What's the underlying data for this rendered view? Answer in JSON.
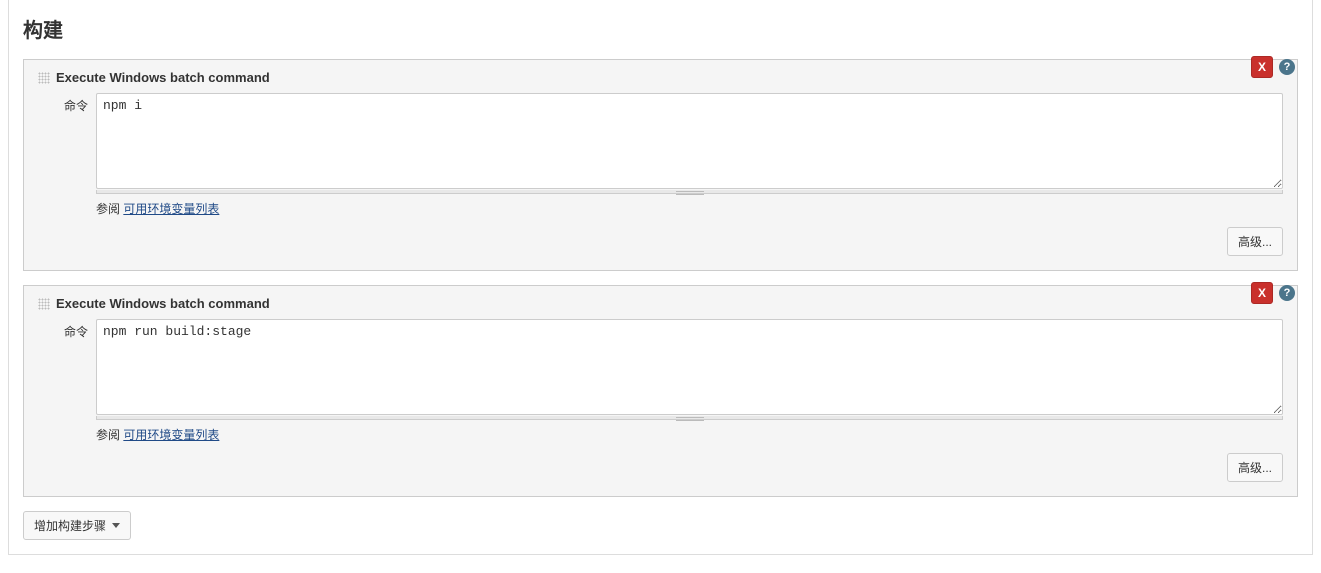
{
  "section_title": "构建",
  "build_steps": [
    {
      "title": "Execute Windows batch command",
      "label": "命令",
      "command": "npm i",
      "refer_prefix": "参阅 ",
      "refer_link_text": "可用环境变量列表",
      "advanced_btn": "高级...",
      "delete_btn": "X"
    },
    {
      "title": "Execute Windows batch command",
      "label": "命令",
      "command": "npm run build:stage",
      "refer_prefix": "参阅 ",
      "refer_link_text": "可用环境变量列表",
      "advanced_btn": "高级...",
      "delete_btn": "X"
    }
  ],
  "add_step_btn": "增加构建步骤"
}
